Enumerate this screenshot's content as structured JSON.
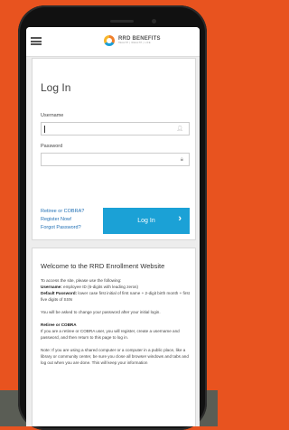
{
  "colors": {
    "background": "#e8531f",
    "accent": "#1ba1d6",
    "link": "#1f6fb5"
  },
  "header": {
    "menu_icon": "hamburger-icon",
    "logo_name": "RRD BENEFITS",
    "logo_tagline": "HEALTH | WEALTH | LIFE"
  },
  "login": {
    "title": "Log In",
    "username_label": "Username",
    "username_icon": "user-icon",
    "password_label": "Password",
    "password_icon": "lock-icon",
    "links": {
      "retiree": "Retiree or COBRA?",
      "register": "Register Now!",
      "forgot": "Forgot Password?"
    },
    "button_label": "Log In",
    "button_icon": "chevron-right-icon"
  },
  "welcome": {
    "title": "Welcome to the RRD Enrollment Website",
    "intro": "To access the site, please use the following:",
    "username_label": "Username:",
    "username_text": "employee ID (6-digits with leading zeros)",
    "password_label": "Default Password:",
    "password_text": "lower case first initial of first name + 2-digit birth month + first five digits of SSN",
    "change_password": "You will be asked to change your password after your initial login.",
    "retiree_heading": "Retiree or COBRA",
    "retiree_text": "If you are a retiree or COBRA user, you will register, create a username and password, and then return to this page to log in.",
    "note_text": "Note: If you are using a shared computer or a computer in a public place, like a library or community center, be sure you close all browser windows and tabs and log out when you are done. This will keep your information"
  }
}
